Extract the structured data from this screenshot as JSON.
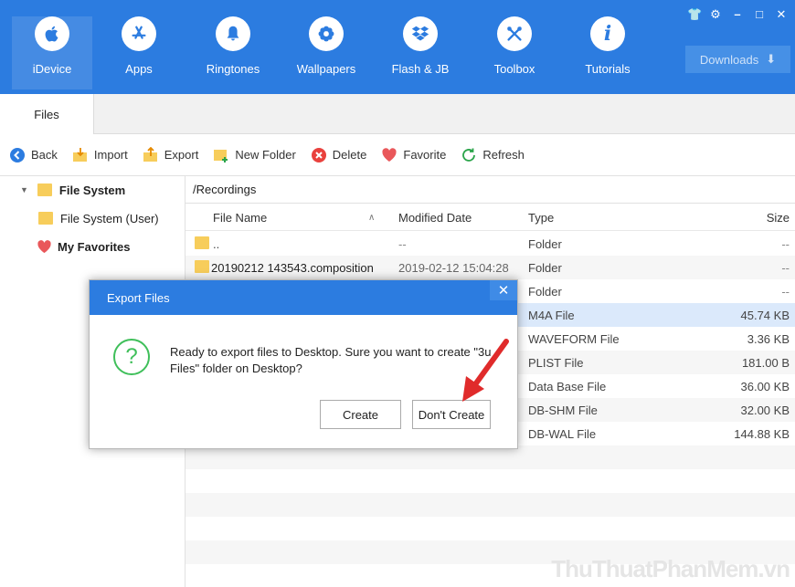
{
  "nav": {
    "items": [
      {
        "label": "iDevice",
        "icon": "apple-icon"
      },
      {
        "label": "Apps",
        "icon": "appstore-icon"
      },
      {
        "label": "Ringtones",
        "icon": "bell-icon"
      },
      {
        "label": "Wallpapers",
        "icon": "flower-icon"
      },
      {
        "label": "Flash & JB",
        "icon": "dropbox-icon"
      },
      {
        "label": "Toolbox",
        "icon": "tools-icon"
      },
      {
        "label": "Tutorials",
        "icon": "info-icon"
      }
    ],
    "downloads_label": "Downloads",
    "accent_color": "#2c7ce0"
  },
  "tabs": {
    "active": "Files"
  },
  "toolbar": {
    "back": "Back",
    "import": "Import",
    "export": "Export",
    "new_folder": "New Folder",
    "delete": "Delete",
    "favorite": "Favorite",
    "refresh": "Refresh"
  },
  "sidebar": {
    "file_system": "File System",
    "file_system_user": "File System (User)",
    "my_favorites": "My Favorites"
  },
  "main": {
    "path": "/Recordings",
    "columns": {
      "name": "File Name",
      "date": "Modified Date",
      "type": "Type",
      "size": "Size"
    },
    "rows": [
      {
        "name": "..",
        "date": "--",
        "type": "Folder",
        "size": "--"
      },
      {
        "name": "20190212 143543.composition",
        "date": "2019-02-12 15:04:28",
        "type": "Folder",
        "size": "--"
      },
      {
        "name": "",
        "date": "",
        "type": "Folder",
        "size": "--"
      },
      {
        "name": "",
        "date": "",
        "type": "M4A File",
        "size": "45.74 KB"
      },
      {
        "name": "",
        "date": "",
        "type": "WAVEFORM File",
        "size": "3.36 KB"
      },
      {
        "name": "",
        "date": "",
        "type": "PLIST File",
        "size": "181.00 B"
      },
      {
        "name": "",
        "date": "",
        "type": "Data Base File",
        "size": "36.00 KB"
      },
      {
        "name": "",
        "date": "",
        "type": "DB-SHM File",
        "size": "32.00 KB"
      },
      {
        "name": "",
        "date": "",
        "type": "DB-WAL File",
        "size": "144.88 KB"
      }
    ]
  },
  "dialog": {
    "title": "Export Files",
    "message": "Ready to export files to Desktop. Sure you want to create \"3u Files\" folder on Desktop?",
    "create_label": "Create",
    "dont_create_label": "Don't Create"
  },
  "watermark": "ThuThuatPhanMem.vn"
}
